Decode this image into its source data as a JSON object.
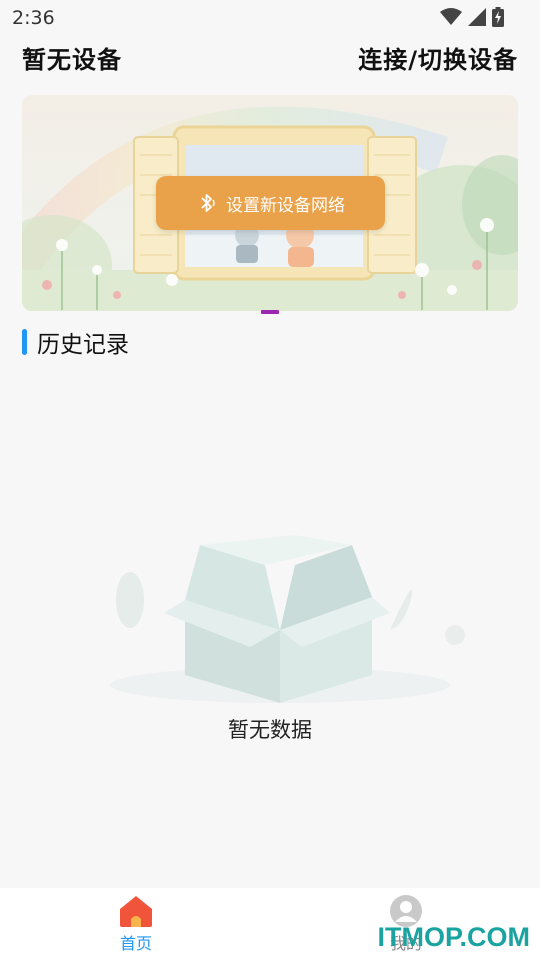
{
  "status_bar": {
    "time": "2:36"
  },
  "header": {
    "device_title": "暂无设备",
    "switch_link": "连接/切换设备"
  },
  "banner": {
    "setup_button_label": "设置新设备网络",
    "icon": "bluetooth-icon"
  },
  "history": {
    "heading": "历史记录",
    "empty_text": "暂无数据"
  },
  "bottom_nav": {
    "items": [
      {
        "label": "首页",
        "icon": "home-icon",
        "active": true
      },
      {
        "label": "我的",
        "icon": "profile-icon",
        "active": false
      }
    ]
  },
  "watermark": "ITMOP.COM",
  "colors": {
    "accent": "#2196f3",
    "setup_button": "#e9a24a",
    "carousel_indicator": "#9c27b0",
    "home_icon": "#f0553b"
  }
}
